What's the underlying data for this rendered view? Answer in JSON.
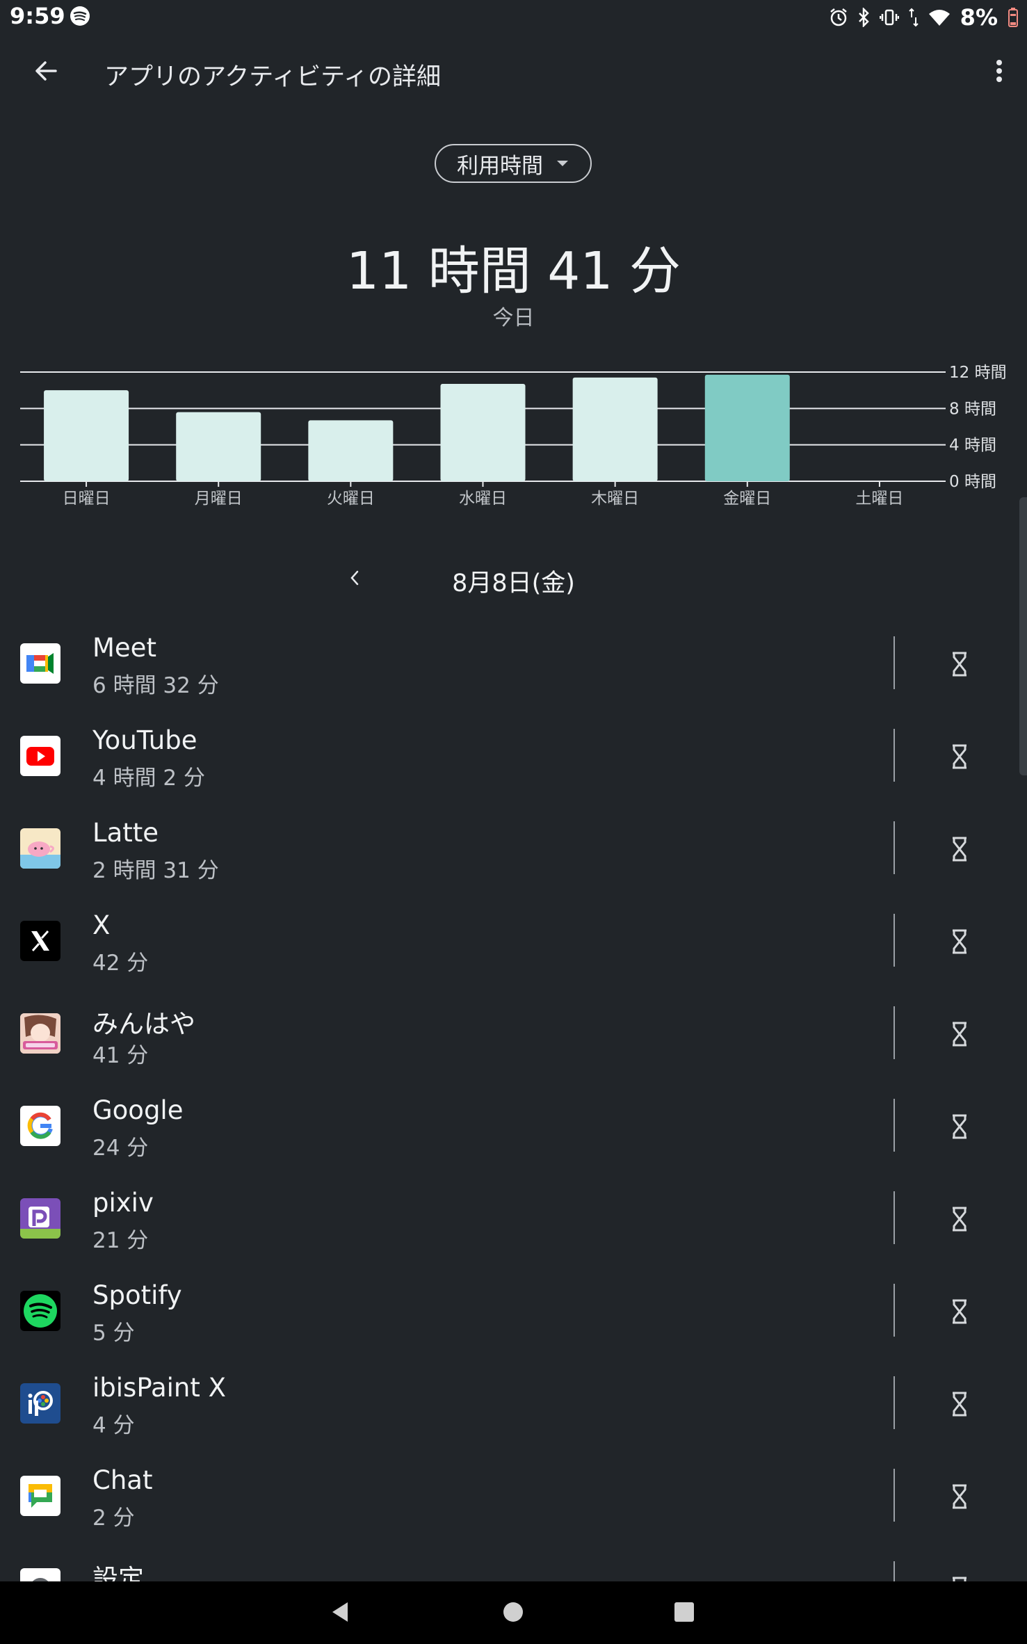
{
  "status_bar": {
    "time": "9:59",
    "battery": "8%"
  },
  "app_bar": {
    "title": "アプリのアクティビティの詳細"
  },
  "metric_dropdown": {
    "label": "利用時間"
  },
  "summary": {
    "total": "11 時間 41 分",
    "period": "今日"
  },
  "chart_data": {
    "type": "bar",
    "categories": [
      "日曜日",
      "月曜日",
      "火曜日",
      "水曜日",
      "木曜日",
      "金曜日",
      "土曜日"
    ],
    "values": [
      10.0,
      7.6,
      6.7,
      10.7,
      11.4,
      11.7,
      0
    ],
    "highlight_index": 5,
    "y_ticks": [
      {
        "value": 12,
        "label": "12 時間"
      },
      {
        "value": 8,
        "label": "8 時間"
      },
      {
        "value": 4,
        "label": "4 時間"
      },
      {
        "value": 0,
        "label": "0 時間"
      }
    ],
    "ylim": [
      0,
      12
    ],
    "colors": {
      "bar": "#d9efec",
      "highlight": "#80cbc4",
      "grid": "#e8eaed"
    }
  },
  "date_nav": {
    "date": "8月8日(金)"
  },
  "apps": [
    {
      "name": "Meet",
      "time": "6 時間 32 分",
      "icon": "meet-icon"
    },
    {
      "name": "YouTube",
      "time": "4 時間 2 分",
      "icon": "youtube-icon"
    },
    {
      "name": "Latte",
      "time": "2 時間 31 分",
      "icon": "latte-icon"
    },
    {
      "name": "X",
      "time": "42 分",
      "icon": "x-icon"
    },
    {
      "name": "みんはや",
      "time": "41 分",
      "icon": "minhaya-icon"
    },
    {
      "name": "Google",
      "time": "24 分",
      "icon": "google-icon"
    },
    {
      "name": "pixiv",
      "time": "21 分",
      "icon": "pixiv-icon"
    },
    {
      "name": "Spotify",
      "time": "5 分",
      "icon": "spotify-icon"
    },
    {
      "name": "ibisPaint X",
      "time": "4 分",
      "icon": "ibispaint-icon"
    },
    {
      "name": "Chat",
      "time": "2 分",
      "icon": "chat-icon"
    },
    {
      "name": "設定",
      "time": "",
      "icon": "settings-icon"
    }
  ]
}
